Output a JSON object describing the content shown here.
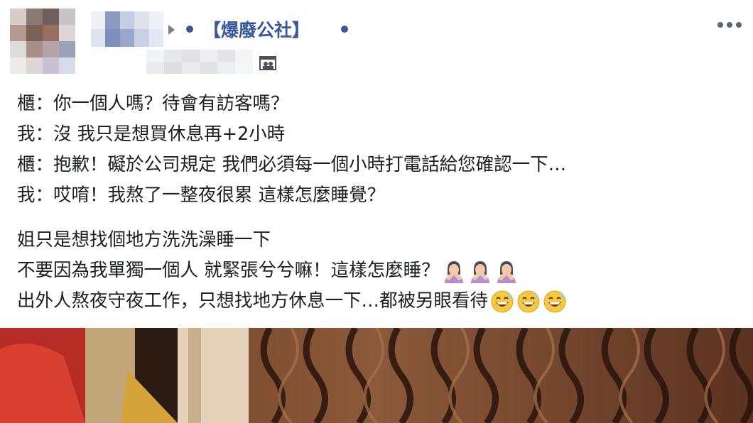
{
  "post": {
    "group_name": "【爆廢公社】",
    "lines": [
      "櫃：你一個人嗎？待會有訪客嗎？",
      "我：沒 我只是想買休息再+2小時",
      "櫃：抱歉！礙於公司規定 我們必須每一個小時打電話給您確認一下…",
      "我：哎唷！我熬了一整夜很累 這樣怎麼睡覺？"
    ],
    "lines2": [
      "姐只是想找個地方洗洗澡睡一下",
      "不要因為我單獨一個人 就緊張兮兮嘛！這樣怎麼睡？",
      "出外人熬夜守夜工作，只想找地方休息一下…都被另眼看待"
    ]
  },
  "icons": {
    "header": [
      "arrow-icon",
      "privacy-icon",
      "more-icon"
    ],
    "emojis_line2": [
      "person-facepalming-icon",
      "person-facepalming-icon",
      "person-facepalming-icon"
    ],
    "emojis_line3": [
      "grinning-sweat-icon",
      "grinning-sweat-icon",
      "grinning-sweat-icon"
    ]
  },
  "colors": {
    "link": "#385898",
    "text": "#1c1e21",
    "background": "#ffffff"
  }
}
